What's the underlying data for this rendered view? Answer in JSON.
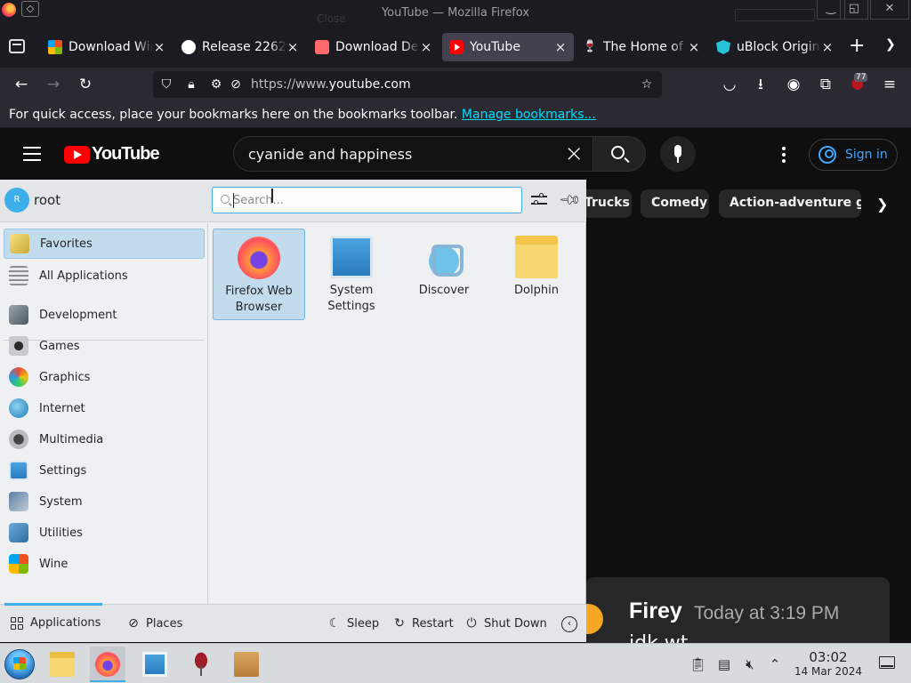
{
  "window": {
    "title": "YouTube — Mozilla Firefox",
    "ghost_label": "Close",
    "controls": {
      "minimize": "‿",
      "maximize": "◱",
      "close": "✕"
    }
  },
  "tabs": [
    {
      "label": "Download Windows",
      "favicon": "windows-logo",
      "active": false
    },
    {
      "label": "Release 2262",
      "favicon": "github-logo",
      "active": false
    },
    {
      "label": "Download Desktop",
      "favicon": "download-site-logo",
      "active": false
    },
    {
      "label": "YouTube",
      "favicon": "youtube-logo",
      "active": true
    },
    {
      "label": "The Home of Wine",
      "favicon": "wine-glass-logo",
      "active": false
    },
    {
      "label": "uBlock Origin",
      "favicon": "ublock-logo",
      "active": false
    }
  ],
  "navbar": {
    "url_prefix": "https://www.",
    "url_domain": "youtube.com",
    "ublock_badge": "77"
  },
  "bookmarks_bar": {
    "message": "For quick access, place your bookmarks here on the bookmarks toolbar.",
    "link": "Manage bookmarks..."
  },
  "youtube": {
    "logo_text": "YouTube",
    "search_query": "cyanide and happiness",
    "sign_in": "Sign in",
    "chips": [
      "Trucks",
      "Comedy",
      "Action-adventure games"
    ],
    "comment": {
      "name": "Firey",
      "time": "Today at 3:19 PM",
      "text": "idk wt"
    }
  },
  "launcher": {
    "user_initial": "R",
    "user_name": "root",
    "search_placeholder": "Search...",
    "categories": [
      {
        "label": "Favorites",
        "icon": "favorites-icon",
        "selected": true
      },
      {
        "label": "All Applications",
        "icon": "all-applications-icon",
        "selected": false
      },
      {
        "label": "Development",
        "icon": "development-icon",
        "selected": false
      },
      {
        "label": "Games",
        "icon": "games-icon",
        "selected": false
      },
      {
        "label": "Graphics",
        "icon": "graphics-icon",
        "selected": false
      },
      {
        "label": "Internet",
        "icon": "internet-icon",
        "selected": false
      },
      {
        "label": "Multimedia",
        "icon": "multimedia-icon",
        "selected": false
      },
      {
        "label": "Settings",
        "icon": "settings-icon",
        "selected": false
      },
      {
        "label": "System",
        "icon": "system-icon",
        "selected": false
      },
      {
        "label": "Utilities",
        "icon": "utilities-icon",
        "selected": false
      },
      {
        "label": "Wine",
        "icon": "wine-icon",
        "selected": false
      }
    ],
    "favorites": [
      {
        "label": "Firefox Web Browser",
        "icon": "firefox-icon",
        "selected": true
      },
      {
        "label": "System Settings",
        "icon": "system-settings-icon",
        "selected": false
      },
      {
        "label": "Discover",
        "icon": "discover-icon",
        "selected": false
      },
      {
        "label": "Dolphin",
        "icon": "dolphin-icon",
        "selected": false
      }
    ],
    "bottom": {
      "applications": "Applications",
      "places": "Places",
      "sleep": "Sleep",
      "restart": "Restart",
      "shutdown": "Shut Down"
    }
  },
  "taskbar": {
    "clock_time": "03:02",
    "clock_date": "14 Mar 2024"
  },
  "colors": {
    "accent": "#3daee9",
    "youtube_red": "#ff0000",
    "link": "#00ddff"
  }
}
